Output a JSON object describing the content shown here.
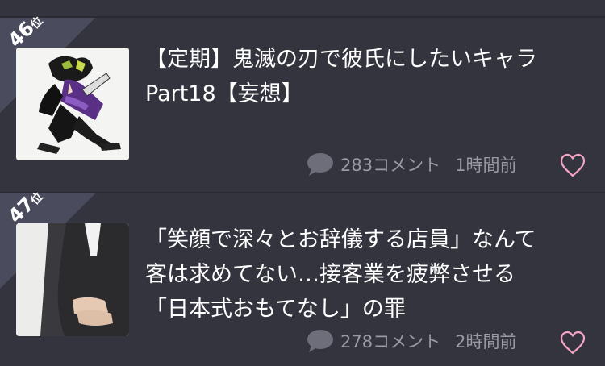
{
  "items": [
    {
      "rank": "46",
      "rank_suffix": "位",
      "title_line1": "【定期】鬼滅の刃で彼氏にしたいキャラ",
      "title_line2": "Part18【妄想】",
      "title_line3": "",
      "comments": "283コメント",
      "time": "1時間前",
      "thumbnail": "anime-character-illustration"
    },
    {
      "rank": "47",
      "rank_suffix": "位",
      "title_line1": "「笑顔で深々とお辞儀する店員」なんて",
      "title_line2": "客は求めてない…接客業を疲弊させる",
      "title_line3": "「日本式おもてなし」の罪",
      "comments": "278コメント",
      "time": "2時間前",
      "thumbnail": "person-in-suit-bowing-photo"
    }
  ],
  "icons": {
    "comment": "speech-bubble-icon",
    "like": "heart-outline-icon"
  },
  "colors": {
    "background": "#34343f",
    "rank_badge": "#4a4c5e",
    "heart": "#f7a5c4",
    "meta_text": "#9a9aa6"
  }
}
